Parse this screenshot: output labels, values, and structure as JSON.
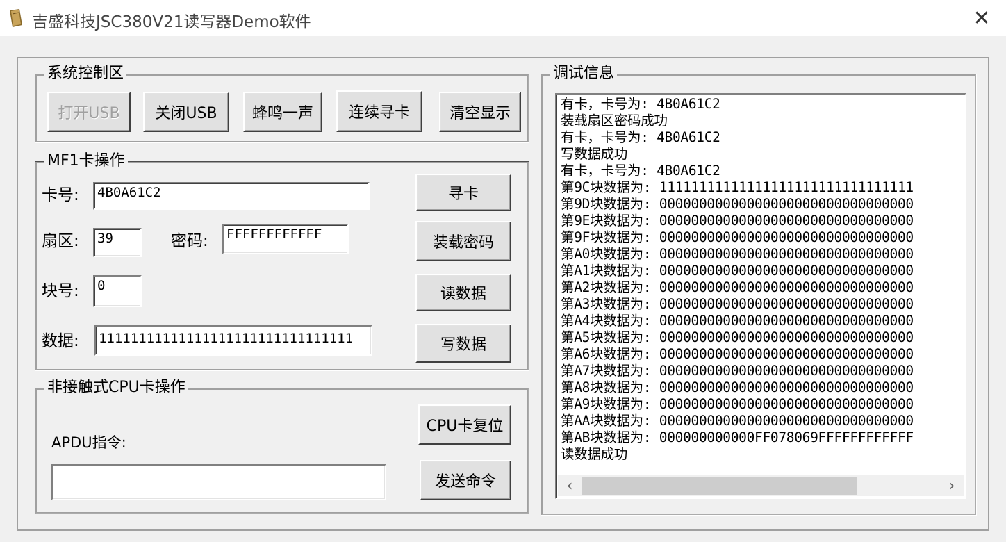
{
  "window": {
    "title": "吉盛科技JSC380V21读写器Demo软件",
    "app_icon": "book-icon",
    "close_glyph": "✕"
  },
  "system_group": {
    "label": "系统控制区",
    "open_usb": "打开USB",
    "close_usb": "关闭USB",
    "beep": "蜂鸣一声",
    "continuous_search": "连续寻卡",
    "clear_display": "清空显示"
  },
  "mf1_group": {
    "label": "MF1卡操作",
    "card_no_label": "卡号:",
    "card_no_value": "4B0A61C2",
    "sector_label": "扇区:",
    "sector_value": "39",
    "key_label": "密码:",
    "key_value": "FFFFFFFFFFFF",
    "block_label": "块号:",
    "block_value": "0",
    "data_label": "数据:",
    "data_value": "11111111111111111111111111111111",
    "search_card_button": "寻卡",
    "load_key_button": "装载密码",
    "read_data_button": "读数据",
    "write_data_button": "写数据"
  },
  "cpu_group": {
    "label": "非接触式CPU卡操作",
    "apdu_label": "APDU指令:",
    "apdu_value": "",
    "reset_button": "CPU卡复位",
    "send_button": "发送命令"
  },
  "debug_group": {
    "label": "调试信息",
    "lines": [
      "有卡，卡号为: 4B0A61C2",
      "装载扇区密码成功",
      "有卡，卡号为: 4B0A61C2",
      "写数据成功",
      "有卡，卡号为: 4B0A61C2",
      "第9C块数据为: 11111111111111111111111111111111",
      "第9D块数据为: 00000000000000000000000000000000",
      "第9E块数据为: 00000000000000000000000000000000",
      "第9F块数据为: 00000000000000000000000000000000",
      "第A0块数据为: 00000000000000000000000000000000",
      "第A1块数据为: 00000000000000000000000000000000",
      "第A2块数据为: 00000000000000000000000000000000",
      "第A3块数据为: 00000000000000000000000000000000",
      "第A4块数据为: 00000000000000000000000000000000",
      "第A5块数据为: 00000000000000000000000000000000",
      "第A6块数据为: 00000000000000000000000000000000",
      "第A7块数据为: 00000000000000000000000000000000",
      "第A8块数据为: 00000000000000000000000000000000",
      "第A9块数据为: 00000000000000000000000000000000",
      "第AA块数据为: 00000000000000000000000000000000",
      "第AB块数据为: 000000000000FF078069FFFFFFFFFFFF",
      "读数据成功"
    ],
    "scroll_left_glyph": "‹",
    "scroll_right_glyph": "›"
  }
}
